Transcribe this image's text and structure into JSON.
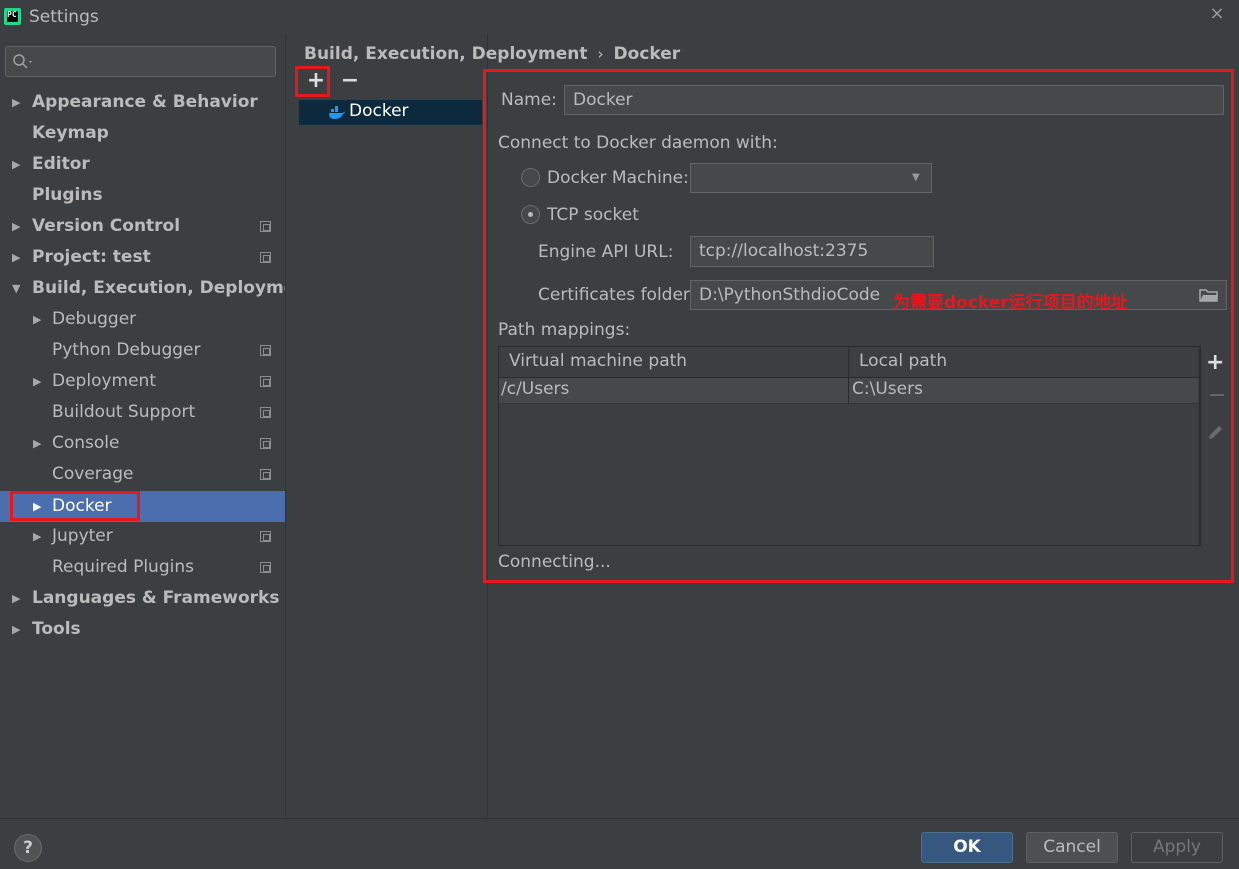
{
  "window": {
    "title": "Settings",
    "close": "×"
  },
  "sidebar": {
    "items": [
      {
        "label": "Appearance & Behavior",
        "arrow": "▶"
      },
      {
        "label": "Keymap"
      },
      {
        "label": "Editor",
        "arrow": "▶"
      },
      {
        "label": "Plugins"
      },
      {
        "label": "Version Control",
        "arrow": "▶"
      },
      {
        "label": "Project: test",
        "arrow": "▶"
      },
      {
        "label": "Build, Execution, Deployment",
        "arrow": "▼"
      },
      {
        "label": "Debugger",
        "arrow": "▶"
      },
      {
        "label": "Python Debugger"
      },
      {
        "label": "Deployment",
        "arrow": "▶"
      },
      {
        "label": "Buildout Support"
      },
      {
        "label": "Console",
        "arrow": "▶"
      },
      {
        "label": "Coverage"
      },
      {
        "label": "Docker",
        "arrow": "▶"
      },
      {
        "label": "Jupyter",
        "arrow": "▶"
      },
      {
        "label": "Required Plugins"
      },
      {
        "label": "Languages & Frameworks",
        "arrow": "▶"
      },
      {
        "label": "Tools",
        "arrow": "▶"
      }
    ]
  },
  "breadcrumb": {
    "parent": "Build, Execution, Deployment",
    "sep": "›",
    "current": "Docker"
  },
  "list": {
    "add": "+",
    "remove": "−",
    "item": "Docker"
  },
  "form": {
    "name_label": "Name:",
    "name_value": "Docker",
    "connect_label": "Connect to Docker daemon with:",
    "docker_machine_label": "Docker Machine:",
    "tcp_socket_label": "TCP socket",
    "engine_api_label": "Engine API URL:",
    "engine_api_value": "tcp://localhost:2375",
    "cert_label": "Certificates folder:",
    "cert_value": "D:\\PythonSthdioCode",
    "annotation": "为需要docker运行项目的地址",
    "path_mappings_label": "Path mappings:",
    "status": "Connecting..."
  },
  "table": {
    "columns": [
      "Virtual machine path",
      "Local path"
    ],
    "rows": [
      [
        "/c/Users",
        "C:\\Users"
      ]
    ],
    "add": "+",
    "remove": "−"
  },
  "footer": {
    "help": "?",
    "ok": "OK",
    "cancel": "Cancel",
    "apply": "Apply"
  },
  "colors": {
    "accent": "#4b6eaf",
    "highlight": "#e8161d",
    "ok_button": "#365880"
  }
}
